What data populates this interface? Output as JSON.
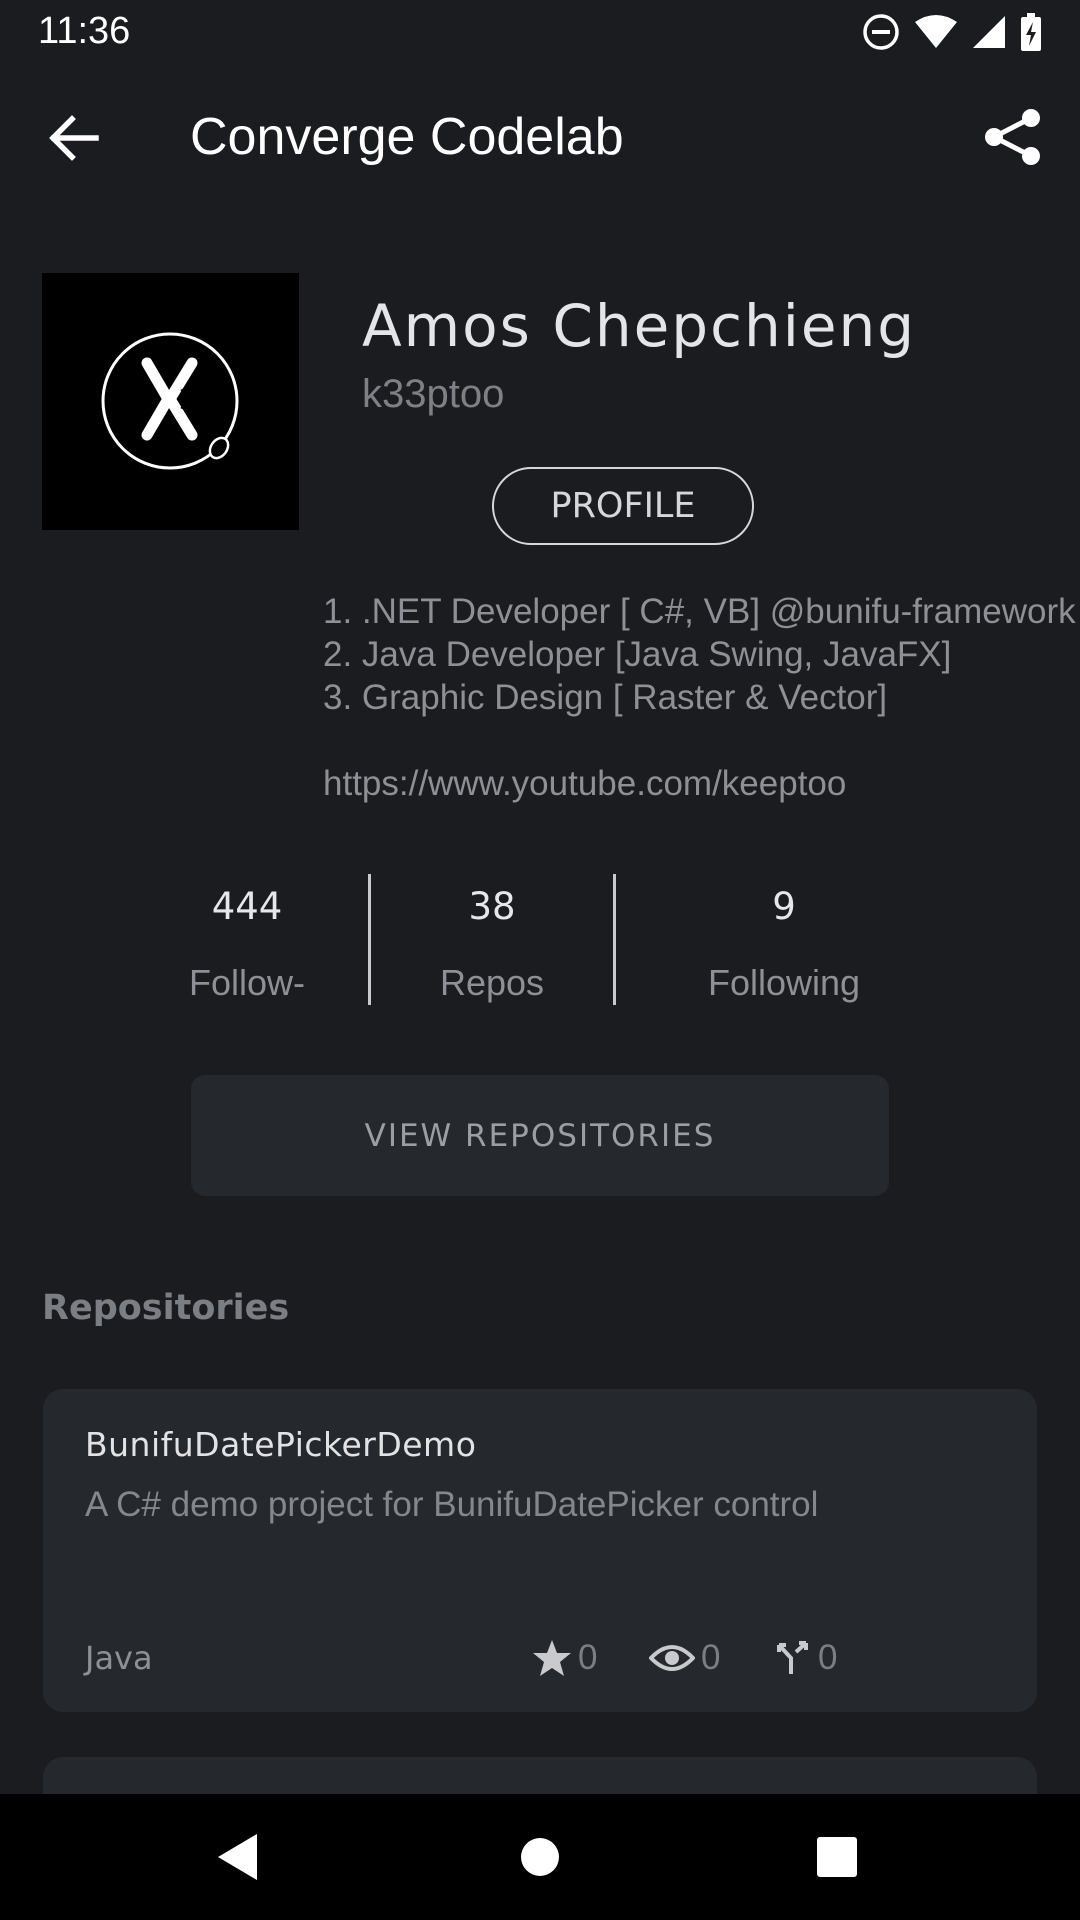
{
  "status_bar": {
    "time": "11:36",
    "icons": [
      "do-not-disturb-icon",
      "wifi-icon",
      "cell-signal-icon",
      "battery-charging-icon"
    ]
  },
  "app_bar": {
    "title": "Converge Codelab",
    "back_icon": "arrow-back-icon",
    "share_icon": "share-icon"
  },
  "profile": {
    "name": "Amos Chepchieng",
    "login": "k33ptoo",
    "profile_button": "PROFILE",
    "bio": [
      "1. .NET Developer [ C#, VB] @bunifu-framework",
      "2. Java Developer [Java Swing, JavaFX]",
      "3. Graphic Design [ Raster & Vector]"
    ],
    "link": "https://www.youtube.com/keeptoo"
  },
  "stats": [
    {
      "count": "444",
      "label": "Follow-"
    },
    {
      "count": "38",
      "label": "Repos"
    },
    {
      "count": "9",
      "label": "Following"
    }
  ],
  "view_repositories_button": "VIEW REPOSITORIES",
  "repositories_section": {
    "title": "Repositories",
    "items": [
      {
        "name": "BunifuDatePickerDemo",
        "description": "A C# demo project for BunifuDatePicker control",
        "language": "Java",
        "stars": "0",
        "watchers": "0",
        "forks": "0"
      }
    ]
  },
  "colors": {
    "background": "#1b1c20",
    "card": "#25282c",
    "text_primary": "#e3e5e8",
    "text_secondary": "#8d9094"
  }
}
